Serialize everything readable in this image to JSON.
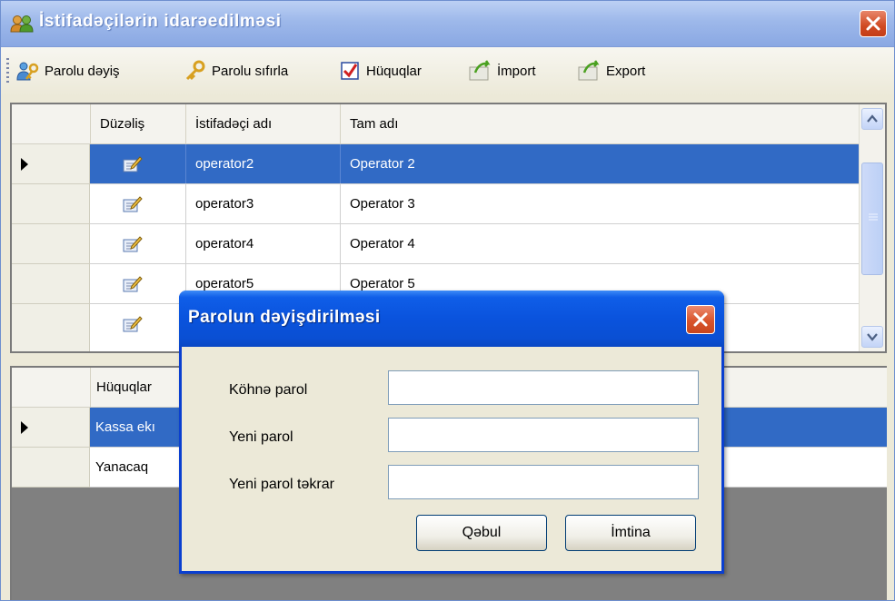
{
  "window": {
    "title": "İstifadəçilərin idarəedilməsi"
  },
  "toolbar": {
    "items": [
      {
        "label": "Parolu dəyiş",
        "icon": "key-user-icon"
      },
      {
        "label": "Parolu sıfırla",
        "icon": "key-reset-icon"
      },
      {
        "label": "Hüquqlar",
        "icon": "checkbox-icon"
      },
      {
        "label": "İmport",
        "icon": "import-icon"
      },
      {
        "label": "Export",
        "icon": "export-icon"
      }
    ]
  },
  "users_grid": {
    "columns": [
      "Düzəliş",
      "İstifadəçi adı",
      "Tam adı"
    ],
    "rows": [
      {
        "username": "operator2",
        "fullname": "Operator 2",
        "selected": true
      },
      {
        "username": "operator3",
        "fullname": "Operator 3",
        "selected": false
      },
      {
        "username": "operator4",
        "fullname": "Operator 4",
        "selected": false
      },
      {
        "username": "operator5",
        "fullname": "Operator 5",
        "selected": false
      },
      {
        "username": "",
        "fullname": "",
        "selected": false
      }
    ]
  },
  "rights_grid": {
    "columns": [
      "Hüquqlar"
    ],
    "rows": [
      {
        "name": "Kassa ekı",
        "selected": true
      },
      {
        "name": "Yanacaq",
        "selected": false
      }
    ]
  },
  "dialog": {
    "title": "Parolun dəyişdirilməsi",
    "old_password_label": "Köhnə parol",
    "new_password_label": "Yeni parol",
    "repeat_password_label": "Yeni parol təkrar",
    "old_password_value": "",
    "new_password_value": "",
    "repeat_password_value": "",
    "accept_label": "Qəbul",
    "cancel_label": "İmtina"
  },
  "colors": {
    "selection": "#316ac5",
    "dialog_title": "#0a53dd",
    "window_title": "#9db8ea"
  }
}
